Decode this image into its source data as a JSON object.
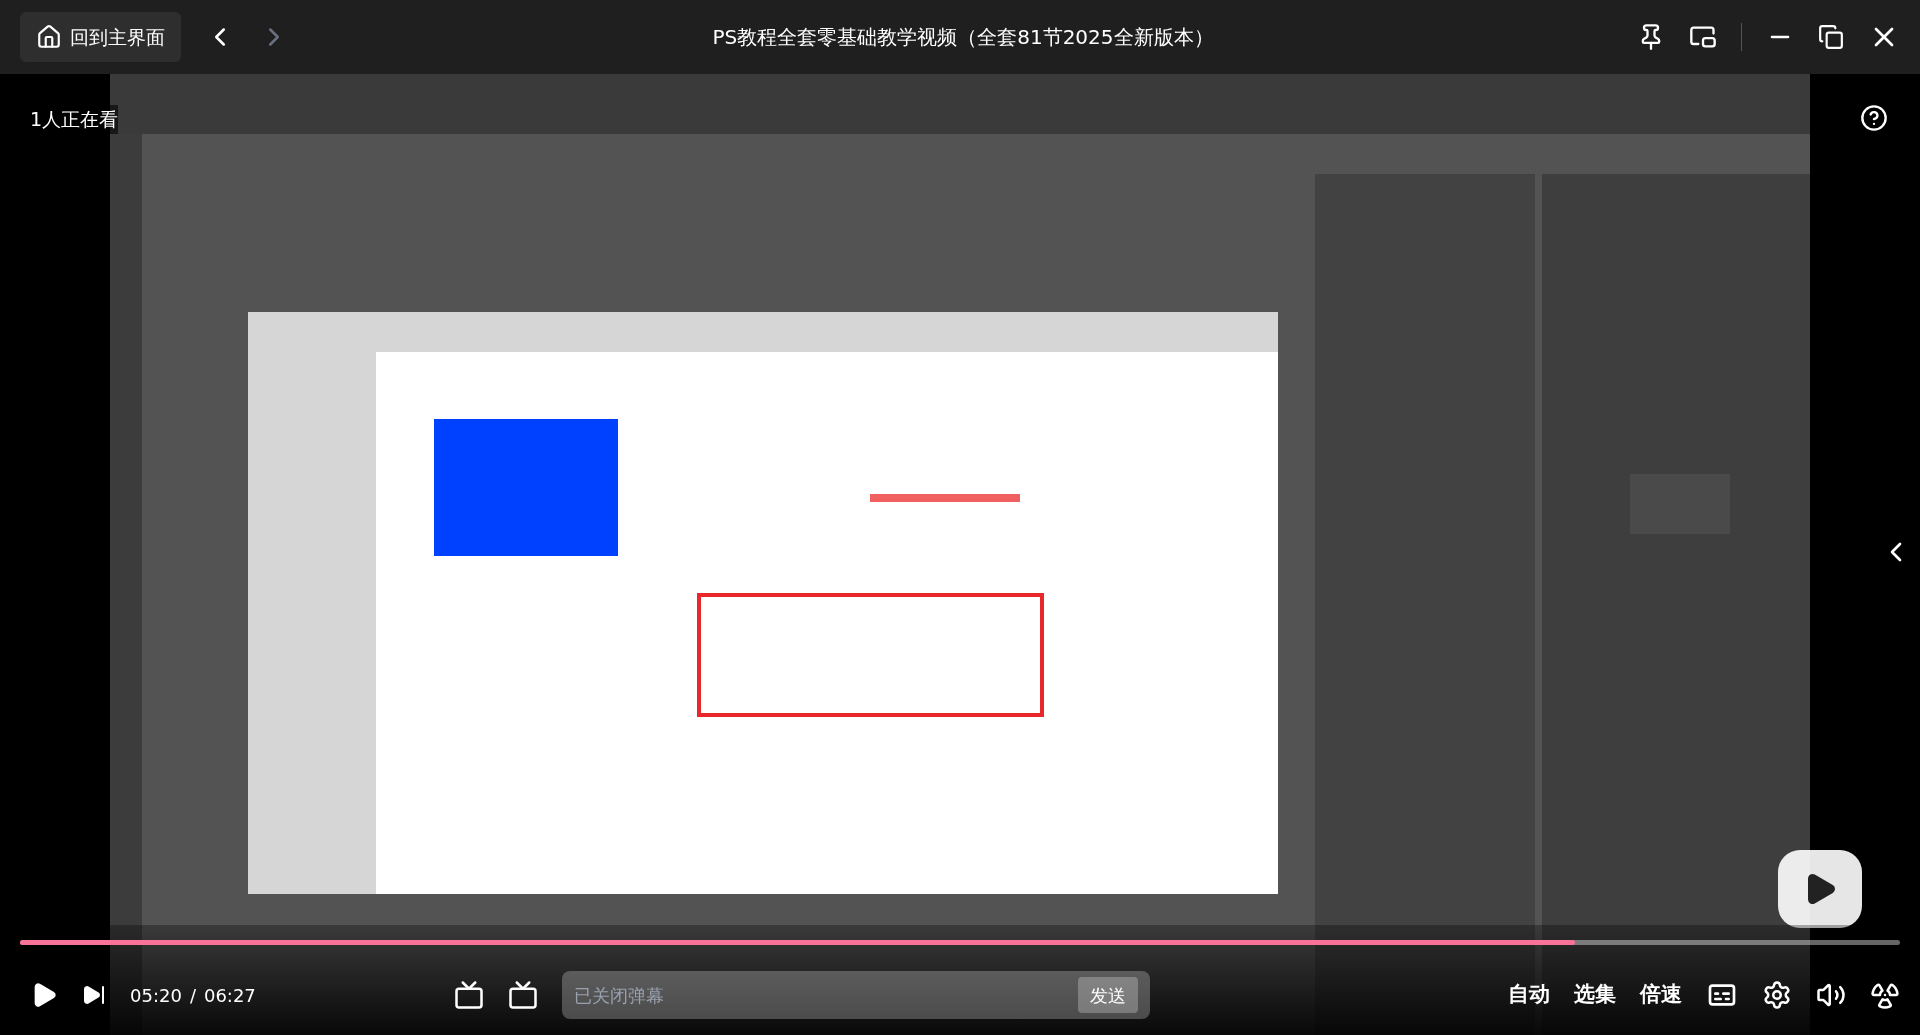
{
  "header": {
    "home_button": "回到主界面",
    "title": "PS教程全套零基础教学视频（全套81节2025全新版本）"
  },
  "viewers": "1人正在看",
  "progress": {
    "level": 0.827
  },
  "time": {
    "current": "05:20",
    "separator": "/",
    "total": "06:27"
  },
  "danmaku": {
    "placeholder": "已关闭弹幕",
    "send": "发送"
  },
  "menu": [
    "自动",
    "选集",
    "倍速"
  ]
}
